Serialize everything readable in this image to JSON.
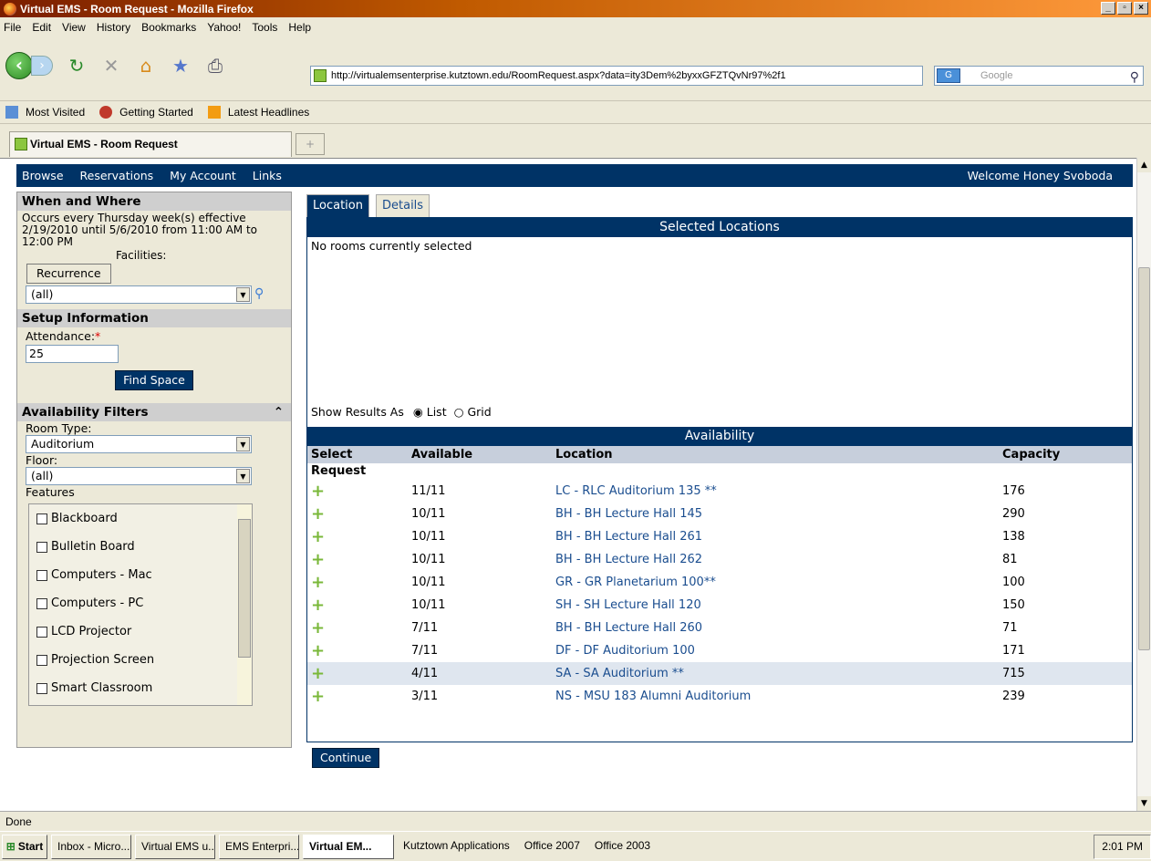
{
  "window": {
    "title": "Virtual EMS - Room Request - Mozilla Firefox"
  },
  "menu": [
    "File",
    "Edit",
    "View",
    "History",
    "Bookmarks",
    "Yahoo!",
    "Tools",
    "Help"
  ],
  "url": "http://virtualemsenterprise.kutztown.edu/RoomRequest.aspx?data=ity3Dem%2byxxGFZTQvNr97%2f1",
  "search": {
    "placeholder": "Google"
  },
  "bookmarks": [
    "Most Visited",
    "Getting Started",
    "Latest Headlines"
  ],
  "tab": {
    "title": "Virtual EMS - Room Request"
  },
  "appnav": {
    "items": [
      "Browse",
      "Reservations",
      "My Account",
      "Links"
    ],
    "welcome": "Welcome Honey Svoboda"
  },
  "left": {
    "when_where": "When and Where",
    "occurrence": "Occurs every Thursday week(s) effective 2/19/2010 until 5/6/2010 from 11:00 AM to 12:00 PM",
    "facilities_label": "Facilities:",
    "recurrence_label": "Recurrence",
    "facility_value": "(all)",
    "setup_title": "Setup Information",
    "attendance_label": "Attendance:",
    "attendance_req": "*",
    "attendance_value": "25",
    "find_space": "Find Space",
    "filters_title": "Availability Filters",
    "room_type_label": "Room Type:",
    "room_type_value": "Auditorium",
    "floor_label": "Floor:",
    "floor_value": "(all)",
    "features_label": "Features",
    "features": [
      "Blackboard",
      "Bulletin Board",
      "Computers - Mac",
      "Computers - PC",
      "LCD Projector",
      "Projection Screen",
      "Smart Classroom"
    ]
  },
  "right": {
    "tabs": [
      "Location",
      "Details"
    ],
    "selected_title": "Selected Locations",
    "no_rooms": "No rooms currently selected",
    "show_results": "Show Results As",
    "list_label": "List",
    "grid_label": "Grid",
    "availability_title": "Availability",
    "columns": [
      "Select",
      "Available",
      "Location",
      "Capacity"
    ],
    "request_label": "Request",
    "rows": [
      {
        "avail": "11/11",
        "loc": "LC - RLC Auditorium 135 **",
        "cap": "176"
      },
      {
        "avail": "10/11",
        "loc": "BH - BH Lecture Hall 145",
        "cap": "290"
      },
      {
        "avail": "10/11",
        "loc": "BH - BH Lecture Hall 261",
        "cap": "138"
      },
      {
        "avail": "10/11",
        "loc": "BH - BH Lecture Hall 262",
        "cap": "81"
      },
      {
        "avail": "10/11",
        "loc": "GR - GR Planetarium 100**",
        "cap": "100"
      },
      {
        "avail": "10/11",
        "loc": "SH - SH Lecture Hall 120",
        "cap": "150"
      },
      {
        "avail": "7/11",
        "loc": "BH - BH Lecture Hall 260",
        "cap": "71"
      },
      {
        "avail": "7/11",
        "loc": "DF - DF Auditorium 100",
        "cap": "171"
      },
      {
        "avail": "4/11",
        "loc": "SA - SA Auditorium **",
        "cap": "715"
      },
      {
        "avail": "3/11",
        "loc": "NS - MSU 183 Alumni Auditorium",
        "cap": "239"
      }
    ],
    "continue": "Continue"
  },
  "status": "Done",
  "taskbar": {
    "start": "Start",
    "items": [
      "Inbox - Micro...",
      "Virtual EMS u...",
      "EMS Enterpri...",
      "Virtual EM...",
      "Kutztown Applications",
      "Office 2007",
      "Office 2003"
    ],
    "clock": "2:01 PM"
  },
  "colors": {
    "brand": "#003366",
    "link": "#1a4d8f",
    "plus": "#7ab83a"
  }
}
